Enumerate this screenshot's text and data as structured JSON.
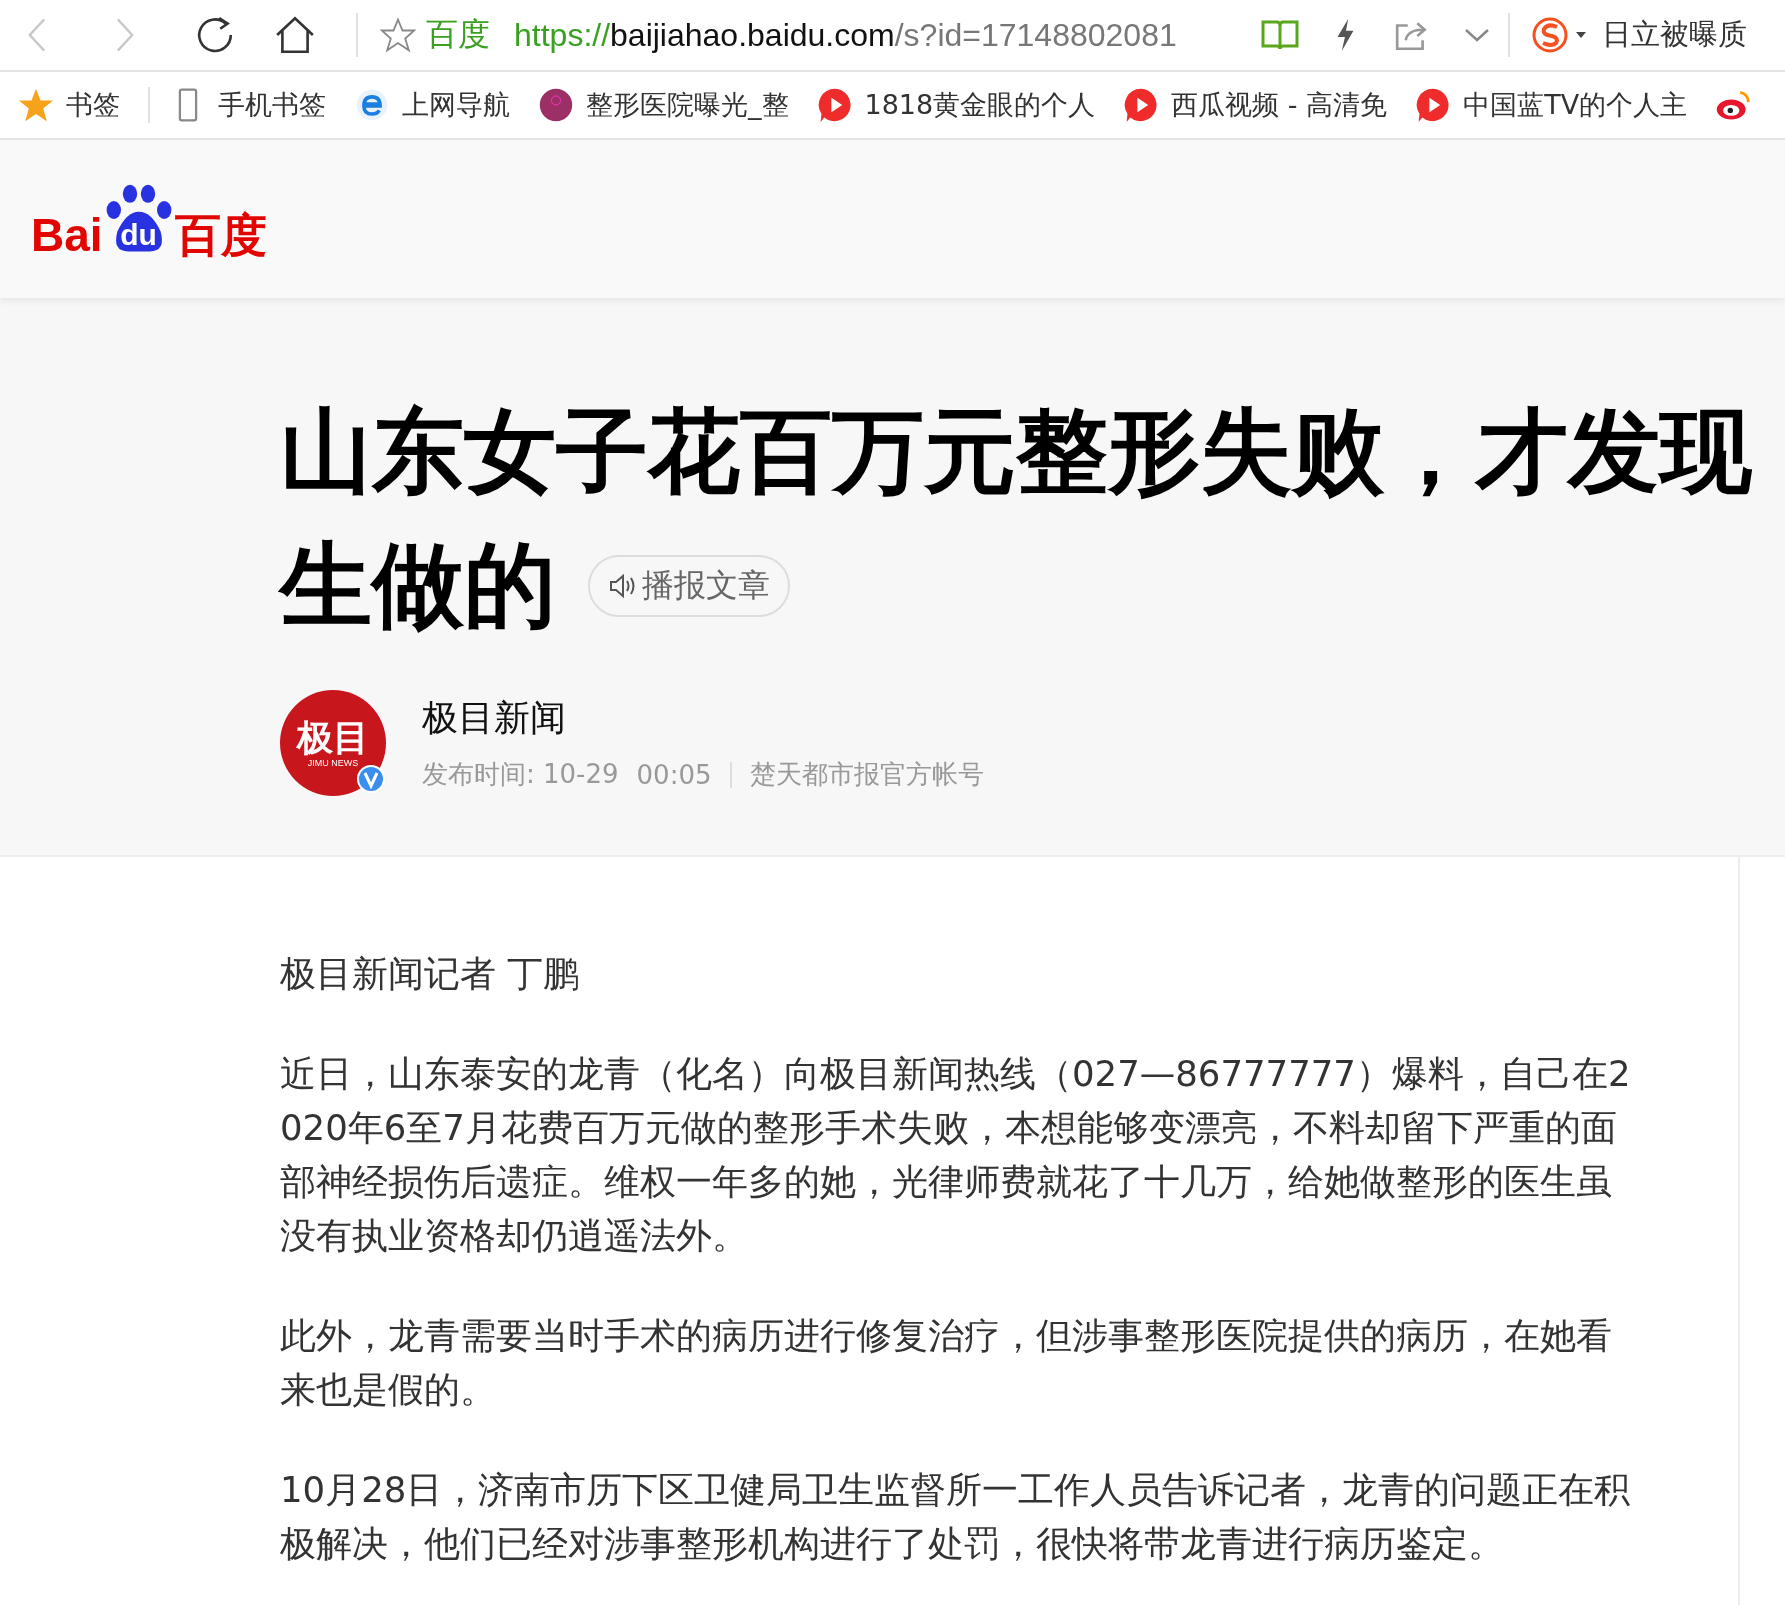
{
  "toolbar": {
    "site_label": "百度",
    "url_scheme": "https://",
    "url_host": "baijiahao.baidu.com",
    "url_path": "/s?id=17148802081",
    "search_text": "日立被曝质"
  },
  "bookmarks": [
    {
      "kind": "star",
      "label": "书签"
    },
    {
      "kind": "phone",
      "label": "手机书签"
    },
    {
      "kind": "ie",
      "label": "上网导航"
    },
    {
      "kind": "circle",
      "label": "整形医院曝光_整"
    },
    {
      "kind": "play",
      "label": "1818黄金眼的个人"
    },
    {
      "kind": "play",
      "label": "西瓜视频 - 高清免"
    },
    {
      "kind": "play",
      "label": "中国蓝TV的个人主"
    },
    {
      "kind": "weibo"
    }
  ],
  "logo": {
    "left": "Bai",
    "paw": "du",
    "right": "百度"
  },
  "article": {
    "title_line_1": "山东女子花百万元整形失败，才发现",
    "title_line_2": "生做的",
    "listen_button": "播报文章",
    "author": {
      "logo_text": "极目",
      "logo_subtext": "JIMU NEWS",
      "verified": true,
      "name": "极目新闻",
      "published": "发布时间: 10-29",
      "time": "00:05",
      "source": "楚天都市报官方帐号"
    },
    "paragraphs": [
      "极目新闻记者 丁鹏",
      "近日，山东泰安的龙青（化名）向极目新闻热线（027—86777777）爆料，自己在2020年6至7月花费百万元做的整形手术失败，本想能够变漂亮，不料却留下严重的面部神经损伤后遗症。维权一年多的她，光律师费就花了十几万，给她做整形的医生虽没有执业资格却仍逍遥法外。",
      "此外，龙青需要当时手术的病历进行修复治疗，但涉事整形医院提供的病历，在她看来也是假的。",
      "10月28日，济南市历下区卫健局卫生监督所一工作人员告诉记者，龙青的问题正在积极解决，他们已经对涉事整形机构进行了处罚，很快将带龙青进行病历鉴定。"
    ]
  }
}
